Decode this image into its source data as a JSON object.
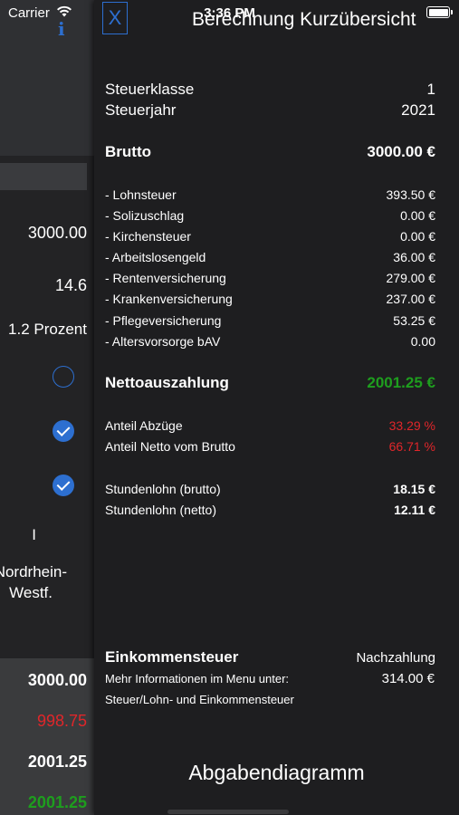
{
  "status_bar": {
    "carrier": "Carrier",
    "time": "3:36 PM"
  },
  "background": {
    "gross": "3000.00",
    "value2": "14.6",
    "percent": "1.2 Prozent",
    "roman": "I",
    "state_line1": "Nordrhein-",
    "state_line2": "Westf.",
    "footer": {
      "v1": "3000.00",
      "v2": "998.75",
      "v3": "2001.25",
      "v4": "2001.25"
    }
  },
  "panel": {
    "close_label": "X",
    "title": "Berechnung Kurzübersicht",
    "steuerklasse": {
      "label": "Steuerklasse",
      "value": "1"
    },
    "steuerjahr": {
      "label": "Steuerjahr",
      "value": "2021"
    },
    "brutto": {
      "label": "Brutto",
      "value": "3000.00 €"
    },
    "deductions": [
      {
        "label": "- Lohnsteuer",
        "value": "393.50 €"
      },
      {
        "label": "- Solizuschlag",
        "value": "0.00 €"
      },
      {
        "label": "- Kirchensteuer",
        "value": "0.00 €"
      },
      {
        "label": "- Arbeitslosengeld",
        "value": "36.00 €"
      },
      {
        "label": "- Rentenversicherung",
        "value": "279.00 €"
      },
      {
        "label": "- Krankenversicherung",
        "value": "237.00 €"
      },
      {
        "label": "- Pflegeversicherung",
        "value": "53.25 €"
      },
      {
        "label": "- Altersvorsorge bAV",
        "value": "0.00"
      }
    ],
    "netto": {
      "label": "Nettoauszahlung",
      "value": "2001.25 €"
    },
    "anteil_abzuege": {
      "label": "Anteil Abzüge",
      "value": "33.29 %"
    },
    "anteil_netto": {
      "label": "Anteil Netto vom Brutto",
      "value": "66.71 %"
    },
    "stundenlohn_brutto": {
      "label": "Stundenlohn (brutto)",
      "value": "18.15 €"
    },
    "stundenlohn_netto": {
      "label": "Stundenlohn (netto)",
      "value": "12.11 €"
    },
    "einkommensteuer": {
      "label": "Einkommensteuer",
      "status": "Nachzahlung",
      "amount": "314.00 €",
      "info_line1": "Mehr Informationen im Menu unter:",
      "info_line2": "Steuer/Lohn- und Einkommensteuer"
    },
    "diagram_button": "Abgabendiagramm"
  },
  "colors": {
    "accent": "#2d6fd0",
    "positive": "#1e9e1e",
    "negative": "#e0262a"
  }
}
